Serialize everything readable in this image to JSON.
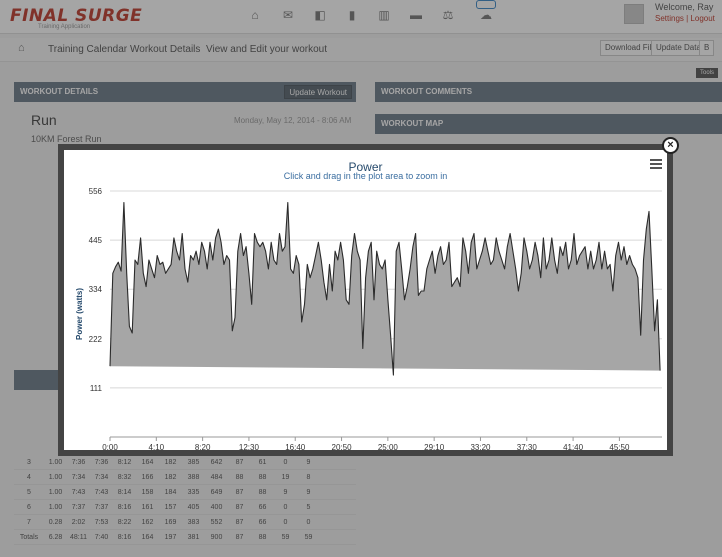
{
  "app": {
    "logo_text": "FINAL SURGE",
    "logo_sub": "Training Application",
    "welcome": "Welcome, Ray",
    "user_links": "Settings | Logout",
    "nav_icons": [
      "home-icon",
      "mail-icon",
      "bag-icon",
      "trash-icon",
      "chart-icon",
      "message-icon",
      "balance-icon",
      "cloud-icon"
    ]
  },
  "breadcrumb": {
    "items": [
      "Training Calendar",
      "Workout Details",
      "View and Edit your workout"
    ]
  },
  "toolbar": {
    "download_file": "Download File",
    "update_data": "Update Data",
    "extra": "B"
  },
  "view_tag": "Tools",
  "panels": {
    "workout_details": "WORKOUT DETAILS",
    "update_workout": "Update Workout",
    "workout_comments": "WORKOUT COMMENTS",
    "workout_map": "WORKOUT MAP"
  },
  "workout": {
    "type": "Run",
    "name": "10KM Forest Run",
    "date": "Monday, May 12, 2014 - 8:06 AM"
  },
  "laps_table": {
    "rows": [
      [
        "3",
        "1.00",
        "7:36",
        "7:36",
        "8:12",
        "164",
        "182",
        "385",
        "642",
        "87",
        "61",
        "0",
        "9"
      ],
      [
        "4",
        "1.00",
        "7:34",
        "7:34",
        "8:32",
        "166",
        "182",
        "388",
        "484",
        "88",
        "88",
        "19",
        "8"
      ],
      [
        "5",
        "1.00",
        "7:43",
        "7:43",
        "8:14",
        "158",
        "184",
        "335",
        "649",
        "87",
        "88",
        "9",
        "9"
      ],
      [
        "6",
        "1.00",
        "7:37",
        "7:37",
        "8:16",
        "161",
        "157",
        "405",
        "400",
        "87",
        "66",
        "0",
        "5"
      ],
      [
        "7",
        "0.28",
        "2:02",
        "7:53",
        "8:22",
        "162",
        "169",
        "383",
        "552",
        "87",
        "66",
        "0",
        "0"
      ],
      [
        "Totals",
        "6.28",
        "48:11",
        "7:40",
        "8:16",
        "164",
        "197",
        "381",
        "900",
        "87",
        "88",
        "59",
        "59"
      ]
    ]
  },
  "chart": {
    "title": "Power",
    "subtitle": "Click and drag in the plot area to zoom in",
    "close_label": "×"
  },
  "chart_data": {
    "type": "area",
    "title": "Power",
    "subtitle": "Click and drag in the plot area to zoom in",
    "xlabel": "",
    "ylabel": "Power (watts)",
    "x_tick_labels": [
      "0:00",
      "4:10",
      "8:20",
      "12:30",
      "16:40",
      "20:50",
      "25:00",
      "29:10",
      "33:20",
      "37:30",
      "41:40",
      "45:50"
    ],
    "y_tick_labels": [
      "111",
      "222",
      "334",
      "445",
      "556"
    ],
    "ylim": [
      0,
      556
    ],
    "xlim_seconds": [
      0,
      2980
    ],
    "grid": true,
    "legend": "none",
    "colors": {
      "line": "#2b2b2b",
      "fill": "#a6a6a6",
      "title": "#274b6d"
    },
    "series": [
      {
        "x_seconds": [
          0,
          15,
          30,
          45,
          60,
          75,
          90,
          105,
          120,
          135,
          150,
          165,
          180,
          195,
          210,
          225,
          240,
          255,
          270,
          285,
          300,
          315,
          330,
          345,
          360,
          375,
          390,
          405,
          420,
          435,
          450,
          465,
          480,
          495,
          510,
          525,
          540,
          555,
          570,
          585,
          600,
          615,
          630,
          645,
          660,
          675,
          690,
          705,
          720,
          735,
          750,
          765,
          780,
          795,
          810,
          825,
          840,
          855,
          870,
          885,
          900,
          915,
          930,
          945,
          960,
          975,
          990,
          1005,
          1020,
          1035,
          1050,
          1065,
          1080,
          1095,
          1110,
          1125,
          1140,
          1155,
          1170,
          1185,
          1200,
          1215,
          1230,
          1245,
          1260,
          1275,
          1290,
          1305,
          1320,
          1335,
          1350,
          1365,
          1380,
          1395,
          1410,
          1425,
          1440,
          1455,
          1470,
          1485,
          1500,
          1515,
          1530,
          1545,
          1560,
          1575,
          1590,
          1605,
          1620,
          1635,
          1650,
          1665,
          1680,
          1695,
          1710,
          1725,
          1740,
          1755,
          1770,
          1785,
          1800,
          1815,
          1830,
          1845,
          1860,
          1875,
          1890,
          1905,
          1920,
          1935,
          1950,
          1965,
          1980,
          1995,
          2010,
          2025,
          2040,
          2055,
          2070,
          2085,
          2100,
          2115,
          2130,
          2145,
          2160,
          2175,
          2190,
          2205,
          2220,
          2235,
          2250,
          2265,
          2280,
          2295,
          2310,
          2325,
          2340,
          2355,
          2370,
          2385,
          2400,
          2415,
          2430,
          2445,
          2460,
          2475,
          2490,
          2505,
          2520,
          2535,
          2550,
          2565,
          2580,
          2595,
          2610,
          2625,
          2640,
          2655,
          2670,
          2685,
          2700,
          2715,
          2730,
          2745,
          2760,
          2775,
          2790,
          2805,
          2820,
          2835,
          2850,
          2865,
          2880,
          2895,
          2910,
          2925,
          2940,
          2955,
          2970,
          2980
        ],
        "values": [
          160,
          370,
          385,
          395,
          375,
          530,
          370,
          250,
          235,
          400,
          390,
          450,
          370,
          340,
          400,
          380,
          360,
          410,
          390,
          395,
          370,
          380,
          390,
          450,
          420,
          400,
          460,
          380,
          350,
          410,
          400,
          420,
          390,
          440,
          420,
          380,
          440,
          400,
          450,
          470,
          440,
          390,
          410,
          400,
          240,
          270,
          420,
          460,
          410,
          430,
          370,
          300,
          460,
          440,
          430,
          440,
          420,
          380,
          440,
          400,
          390,
          460,
          420,
          430,
          530,
          380,
          370,
          410,
          390,
          260,
          300,
          390,
          360,
          380,
          410,
          440,
          400,
          350,
          310,
          390,
          330,
          420,
          400,
          440,
          400,
          310,
          300,
          410,
          460,
          420,
          400,
          200,
          360,
          420,
          440,
          310,
          420,
          390,
          380,
          400,
          310,
          230,
          140,
          420,
          440,
          380,
          310,
          340,
          380,
          430,
          460,
          320,
          330,
          330,
          380,
          400,
          420,
          370,
          410,
          430,
          390,
          400,
          440,
          340,
          350,
          360,
          340,
          450,
          420,
          370,
          440,
          460,
          380,
          400,
          420,
          450,
          420,
          390,
          400,
          450,
          420,
          400,
          380,
          430,
          460,
          420,
          380,
          330,
          370,
          450,
          420,
          380,
          400,
          440,
          410,
          360,
          450,
          380,
          400,
          450,
          400,
          370,
          430,
          410,
          440,
          380,
          400,
          460,
          390,
          410,
          420,
          430,
          380,
          420,
          380,
          400,
          440,
          380,
          420,
          380,
          390,
          330,
          410,
          440,
          400,
          430,
          390,
          410,
          390,
          380,
          360,
          230,
          400,
          470,
          510,
          380,
          240,
          310,
          150
        ]
      }
    ]
  }
}
